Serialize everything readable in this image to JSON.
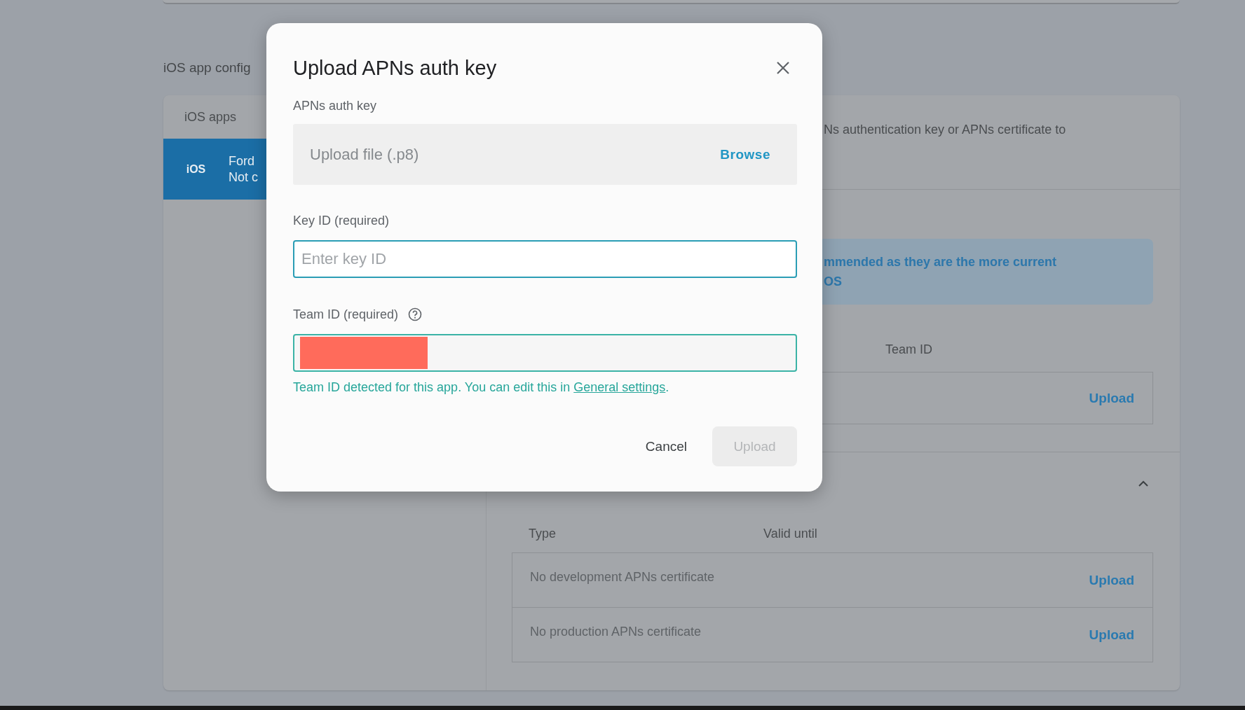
{
  "page": {
    "section_title": "iOS app config",
    "apps_header": "iOS apps",
    "apps": [
      {
        "badge": "iOS",
        "name": "Ford",
        "status": "Not c",
        "selected": true
      }
    ],
    "description": "Ns authentication key or APNs certificate to",
    "banner_lines": [
      "mmended as they are the more current",
      "OS"
    ],
    "key_table": {
      "columns": [
        "Team ID"
      ],
      "rows": [
        {
          "action": "Upload"
        }
      ]
    },
    "cert_section": {
      "expanded": true,
      "columns": [
        "Type",
        "Valid until"
      ],
      "rows": [
        {
          "type": "No development APNs certificate",
          "action": "Upload"
        },
        {
          "type": "No production APNs certificate",
          "action": "Upload"
        }
      ]
    }
  },
  "dialog": {
    "title": "Upload APNs auth key",
    "file_label": "APNs auth key",
    "file_placeholder": "Upload file (.p8)",
    "browse": "Browse",
    "key_label": "Key ID (required)",
    "key_placeholder": "Enter key ID",
    "team_label": "Team ID (required)",
    "team_redacted": true,
    "helper": "Team ID detected for this app. You can edit this in ",
    "helper_link": "General settings",
    "helper_end": ".",
    "cancel": "Cancel",
    "upload": "Upload",
    "upload_disabled": true
  }
}
